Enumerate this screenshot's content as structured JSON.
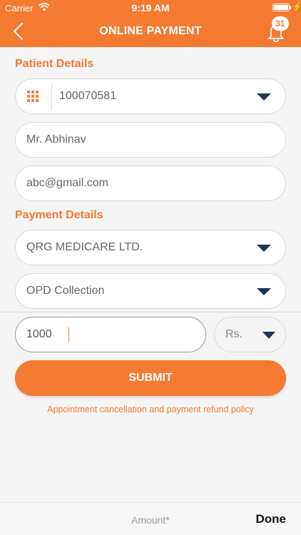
{
  "status_bar": {
    "carrier": "Carrier",
    "time": "9:19 AM"
  },
  "nav": {
    "title": "ONLINE PAYMENT",
    "notifications_count": "31"
  },
  "patient": {
    "section_title": "Patient Details",
    "id_value": "100070581",
    "name_value": "Mr. Abhinav",
    "email_value": "abc@gmail.com"
  },
  "payment": {
    "section_title": "Payment Details",
    "company_value": "QRG MEDICARE LTD.",
    "type_value": "OPD Collection",
    "amount_value": "1000",
    "currency_value": "Rs."
  },
  "submit_label": "SUBMIT",
  "policy_link": "Appointment cancellation and payment refund policy",
  "keyboard_accessory": {
    "label": "Amount*",
    "done": "Done"
  },
  "colors": {
    "accent": "#f47a32",
    "caret": "#1f3452",
    "background": "#f5f5f5"
  }
}
